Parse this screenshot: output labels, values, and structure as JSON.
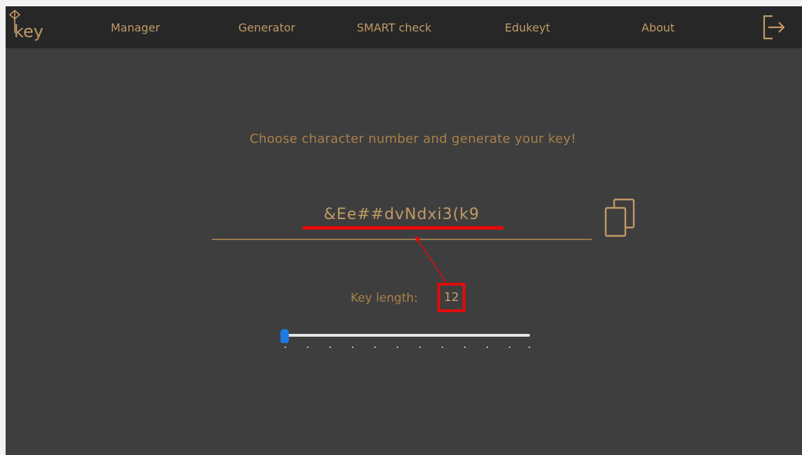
{
  "navbar": {
    "logo_text": "key",
    "items": [
      {
        "label": "Manager"
      },
      {
        "label": "Generator"
      },
      {
        "label": "SMART check"
      },
      {
        "label": "Edukeyt"
      },
      {
        "label": "About"
      }
    ],
    "logout_icon": "logout-icon"
  },
  "generator": {
    "headline": "Choose character number and generate your key!",
    "key": "&Ee##dvNdxi3(k9",
    "copy_icon": "copy-icon",
    "length_label": "Key length:",
    "length_value": "12",
    "slider_level": 0
  },
  "colors": {
    "background": "#3e3e3e",
    "navbar": "#272727",
    "accent": "#c19a66",
    "annotation": "#e30b0b",
    "slider_thumb": "#1b7be0"
  }
}
